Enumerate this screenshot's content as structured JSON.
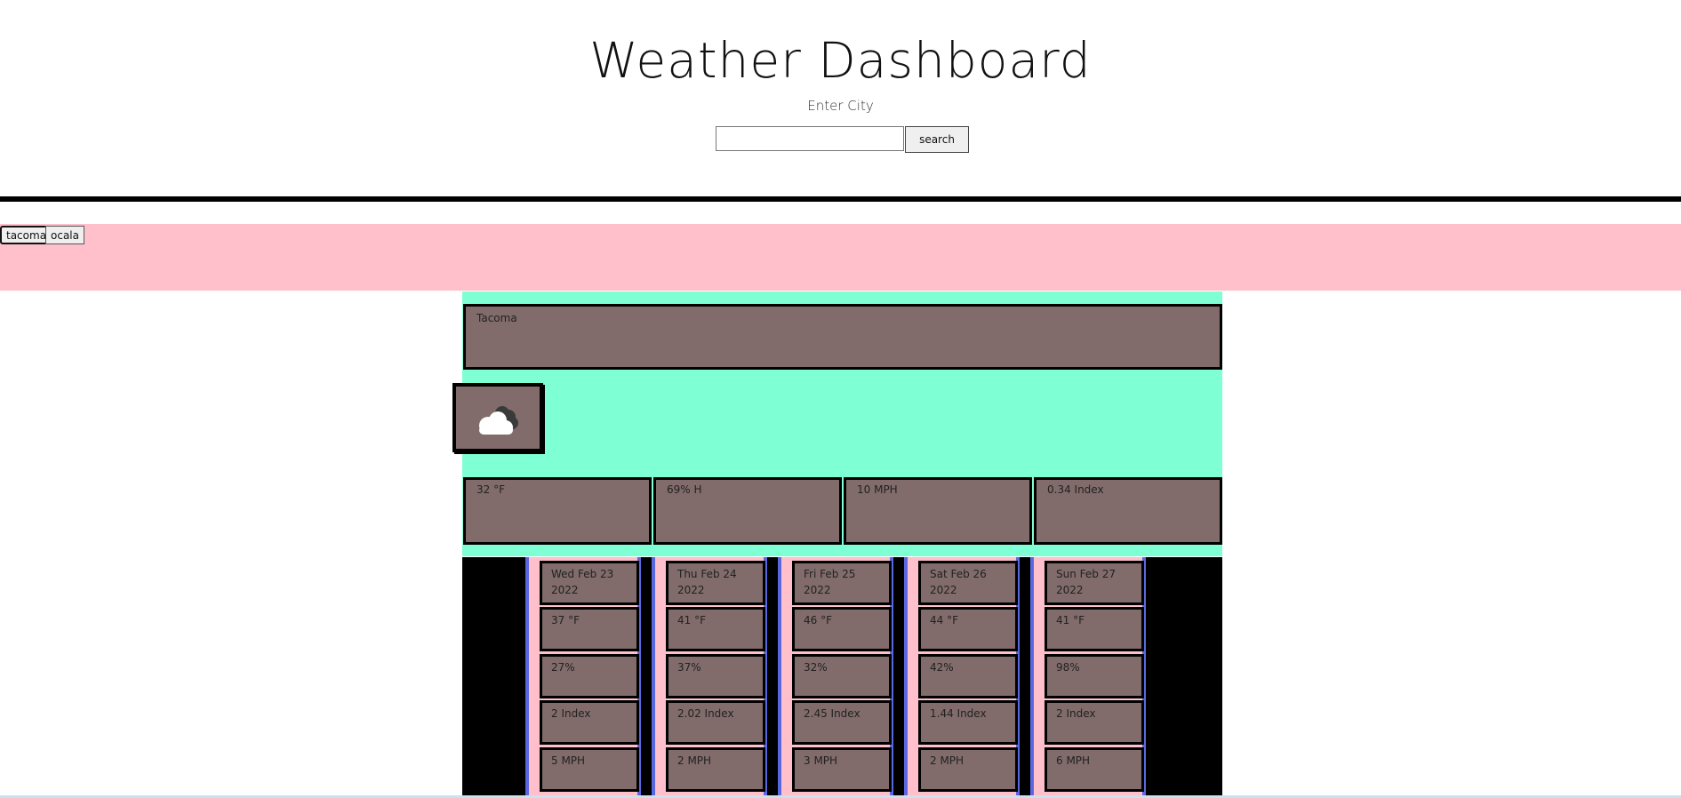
{
  "header": {
    "title": "Weather Dashboard",
    "subtitle": "Enter City",
    "search_placeholder": "",
    "search_button_label": "search"
  },
  "history": [
    "tacoma",
    "ocala"
  ],
  "current": {
    "city": "Tacoma",
    "icon": "cloud-icon",
    "temp": "32 °F",
    "humidity": "69% H",
    "wind": "10 MPH",
    "uv": "0.34 Index"
  },
  "forecast": [
    {
      "date": "Wed Feb 23 2022",
      "temp": "37 °F",
      "humidity": "27%",
      "uv": "2 Index",
      "wind": "5 MPH"
    },
    {
      "date": "Thu Feb 24 2022",
      "temp": "41 °F",
      "humidity": "37%",
      "uv": "2.02 Index",
      "wind": "2 MPH"
    },
    {
      "date": "Fri Feb 25 2022",
      "temp": "46 °F",
      "humidity": "32%",
      "uv": "2.45 Index",
      "wind": "3 MPH"
    },
    {
      "date": "Sat Feb 26 2022",
      "temp": "44 °F",
      "humidity": "42%",
      "uv": "1.44 Index",
      "wind": "2 MPH"
    },
    {
      "date": "Sun Feb 27 2022",
      "temp": "41 °F",
      "humidity": "98%",
      "uv": "2 Index",
      "wind": "6 MPH"
    }
  ],
  "colors": {
    "history_bg": "#ffc0cb",
    "current_bg": "#7fffd4",
    "card_bg": "#816b6b",
    "forecast_border": "#5a68e0"
  }
}
